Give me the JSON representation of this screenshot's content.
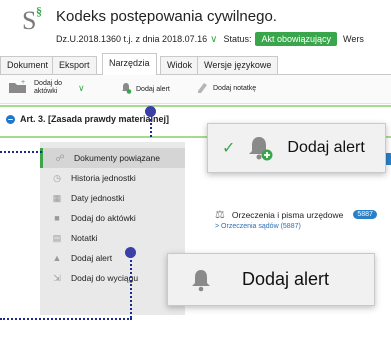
{
  "header": {
    "logo_mark": "S",
    "logo_sup": "§",
    "title": "Kodeks postępowania cywilnego.",
    "reference": "Dz.U.2018.1360 t.j. z dnia 2018.07.16",
    "status_label": "Status:",
    "status_value": "Akt obowiązujący",
    "trailing": "Wers"
  },
  "tabs": [
    "Dokument",
    "Eksport",
    "Narzędzia",
    "Widok",
    "Wersje językowe"
  ],
  "active_tab": "Narzędzia",
  "toolbar": {
    "add_to_folder_line1": "Dodaj do",
    "add_to_folder_line2": "aktówki",
    "add_alert": "Dodaj alert",
    "add_note": "Dodaj notatkę"
  },
  "article": {
    "title": "Art.  3.  [Zasada prawdy materialnej]"
  },
  "side_menu": [
    {
      "label": "Dokumenty powiązane",
      "icon": "link-icon",
      "active": true
    },
    {
      "label": "Historia jednostki",
      "icon": "clock-icon",
      "active": false
    },
    {
      "label": "Daty jednostki",
      "icon": "calendar-icon",
      "active": false
    },
    {
      "label": "Dodaj do aktówki",
      "icon": "folder-plus-icon",
      "active": false
    },
    {
      "label": "Notatki",
      "icon": "note-icon",
      "active": false
    },
    {
      "label": "Dodaj alert",
      "icon": "bell-icon",
      "active": false
    },
    {
      "label": "Dodaj do wyciągu",
      "icon": "extract-icon",
      "active": false
    }
  ],
  "content": {
    "section_label": "Orzeczenia i pisma urzędowe",
    "section_count": "5887",
    "link": "Orzeczenia sądów (5887)"
  },
  "callout_top": {
    "label": "Dodaj alert"
  },
  "callout_bottom": {
    "label": "Dodaj alert"
  },
  "colors": {
    "accent_green": "#3aa64b",
    "accent_blue": "#2a7fc9",
    "marker": "#3b3fa8"
  }
}
